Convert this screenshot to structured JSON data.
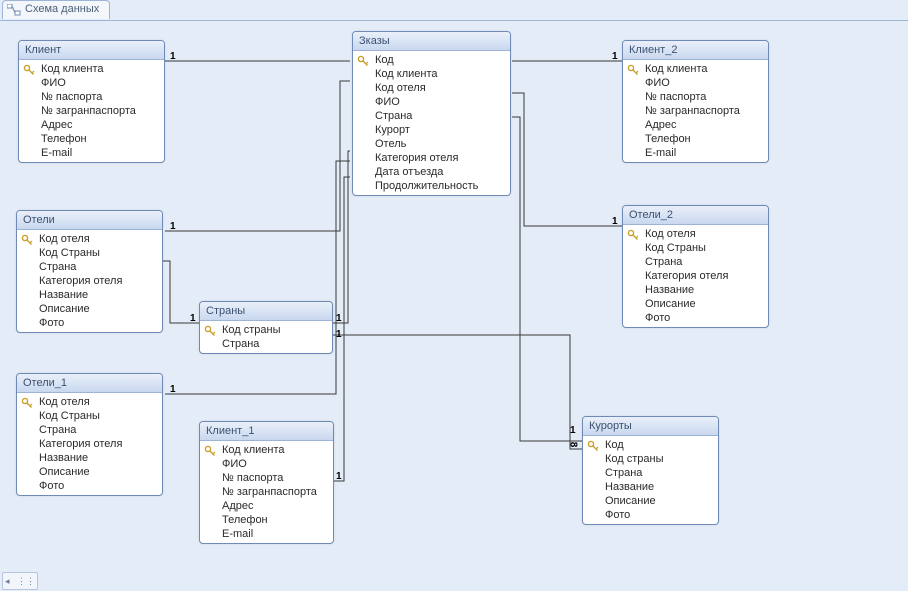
{
  "tab": {
    "title": "Схема данных"
  },
  "tables": {
    "klient": {
      "title": "Клиент",
      "fields": [
        "Код клиента",
        "ФИО",
        "№ паспорта",
        "№ загранпаспорта",
        "Адрес",
        "Телефон",
        "E-mail"
      ]
    },
    "klient_1": {
      "title": "Клиент_1",
      "fields": [
        "Код клиента",
        "ФИО",
        "№ паспорта",
        "№ загранпаспорта",
        "Адрес",
        "Телефон",
        "E-mail"
      ]
    },
    "klient_2": {
      "title": "Клиент_2",
      "fields": [
        "Код клиента",
        "ФИО",
        "№ паспорта",
        "№ загранпаспорта",
        "Адрес",
        "Телефон",
        "E-mail"
      ]
    },
    "zakazy": {
      "title": "Зказы",
      "fields": [
        "Код",
        "Код клиента",
        "Код отеля",
        "ФИО",
        "Страна",
        "Курорт",
        "Отель",
        "Категория отеля",
        "Дата отъезда",
        "Продолжительность"
      ]
    },
    "oteli": {
      "title": "Отели",
      "fields": [
        "Код отеля",
        "Код Страны",
        "Страна",
        "Категория отеля",
        "Название",
        "Описание",
        "Фото"
      ]
    },
    "oteli_1": {
      "title": "Отели_1",
      "fields": [
        "Код отеля",
        "Код Страны",
        "Страна",
        "Категория отеля",
        "Название",
        "Описание",
        "Фото"
      ]
    },
    "oteli_2": {
      "title": "Отели_2",
      "fields": [
        "Код отеля",
        "Код Страны",
        "Страна",
        "Категория отеля",
        "Название",
        "Описание",
        "Фото"
      ]
    },
    "strany": {
      "title": "Страны",
      "fields": [
        "Код страны",
        "Страна"
      ]
    },
    "kurorty": {
      "title": "Курорты",
      "fields": [
        "Код",
        "Код страны",
        "Страна",
        "Название",
        "Описание",
        "Фото"
      ]
    }
  },
  "relationships": [
    {
      "from": "klient",
      "from_card": "1",
      "to": "zakazy",
      "to_card": "∞"
    },
    {
      "from": "klient_1",
      "from_card": "1",
      "to": "zakazy",
      "to_card": "∞"
    },
    {
      "from": "klient_2",
      "from_card": "1",
      "to": "zakazy",
      "to_card": "∞"
    },
    {
      "from": "oteli",
      "from_card": "1",
      "to": "zakazy",
      "to_card": "∞"
    },
    {
      "from": "oteli_1",
      "from_card": "1",
      "to": "zakazy",
      "to_card": "∞"
    },
    {
      "from": "oteli_2",
      "from_card": "1",
      "to": "zakazy",
      "to_card": "∞"
    },
    {
      "from": "strany",
      "from_card": "1",
      "to": "zakazy",
      "to_card": "∞"
    },
    {
      "from": "strany",
      "from_card": "1",
      "to": "oteli",
      "to_card": "∞"
    },
    {
      "from": "strany",
      "from_card": "1",
      "to": "kurorty",
      "to_card": "∞"
    },
    {
      "from": "kurorty",
      "from_card": "1",
      "to": "zakazy",
      "to_card": "∞"
    }
  ]
}
